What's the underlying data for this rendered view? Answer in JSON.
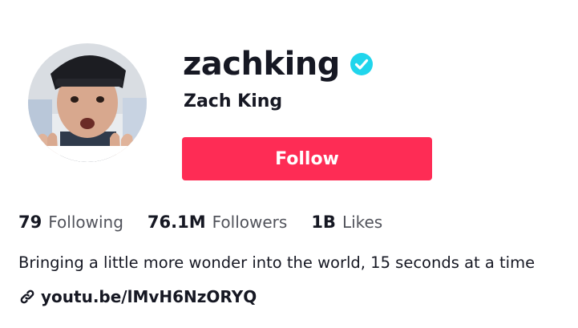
{
  "profile": {
    "username": "zachking",
    "display_name": "Zach King",
    "verified": true,
    "follow_label": "Follow",
    "accent_color": "#fe2c55",
    "verified_color": "#20d5ec"
  },
  "stats": [
    {
      "value": "79",
      "label": "Following"
    },
    {
      "value": "76.1M",
      "label": "Followers"
    },
    {
      "value": "1B",
      "label": "Likes"
    }
  ],
  "bio": "Bringing a little more wonder into the world, 15 seconds at a time",
  "link": {
    "icon": "link-icon",
    "text": "youtu.be/lMvH6NzORYQ"
  },
  "icons": {
    "verified": "verified-badge-icon",
    "avatar": "avatar"
  }
}
